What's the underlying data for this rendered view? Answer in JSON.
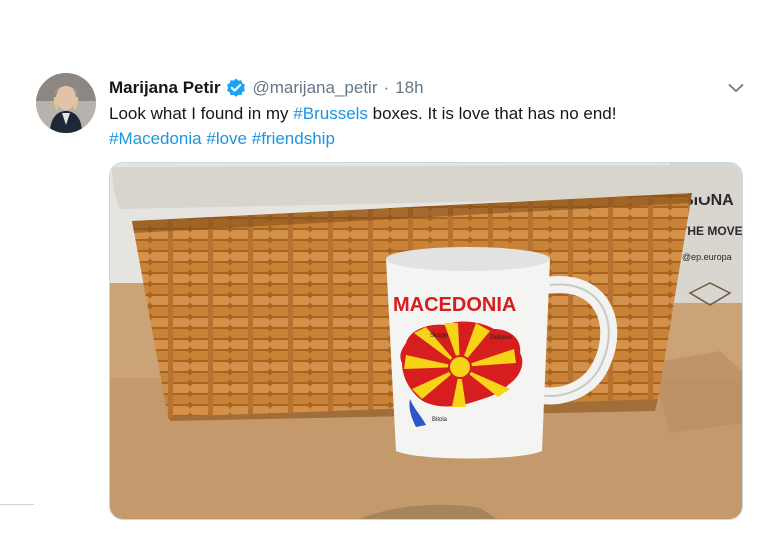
{
  "tweet": {
    "author_name": "Marijana Petir",
    "handle": "@marijana_petir",
    "separator": "·",
    "timestamp": "18h",
    "text_before": "Look what I found in my ",
    "hashtag_1": "#Brussels",
    "text_after": " boxes. It is love that has no end!",
    "hashtag_2": "#Macedonia",
    "hashtag_3": "#love",
    "hashtag_4": "#friendship"
  },
  "media": {
    "mug_text": "MACEDONIA",
    "box_text_1": "SIONA",
    "box_text_2": "THE MOVE",
    "box_text_3": "@ep.europa",
    "map_labels": [
      "Skopje",
      "Delcevo",
      "Bitola"
    ]
  },
  "colors": {
    "link": "#1b95e0",
    "verified": "#1da1f2",
    "muted": "#657786"
  },
  "icons": {
    "verified": "verified-badge-icon",
    "caret": "chevron-down-icon"
  }
}
